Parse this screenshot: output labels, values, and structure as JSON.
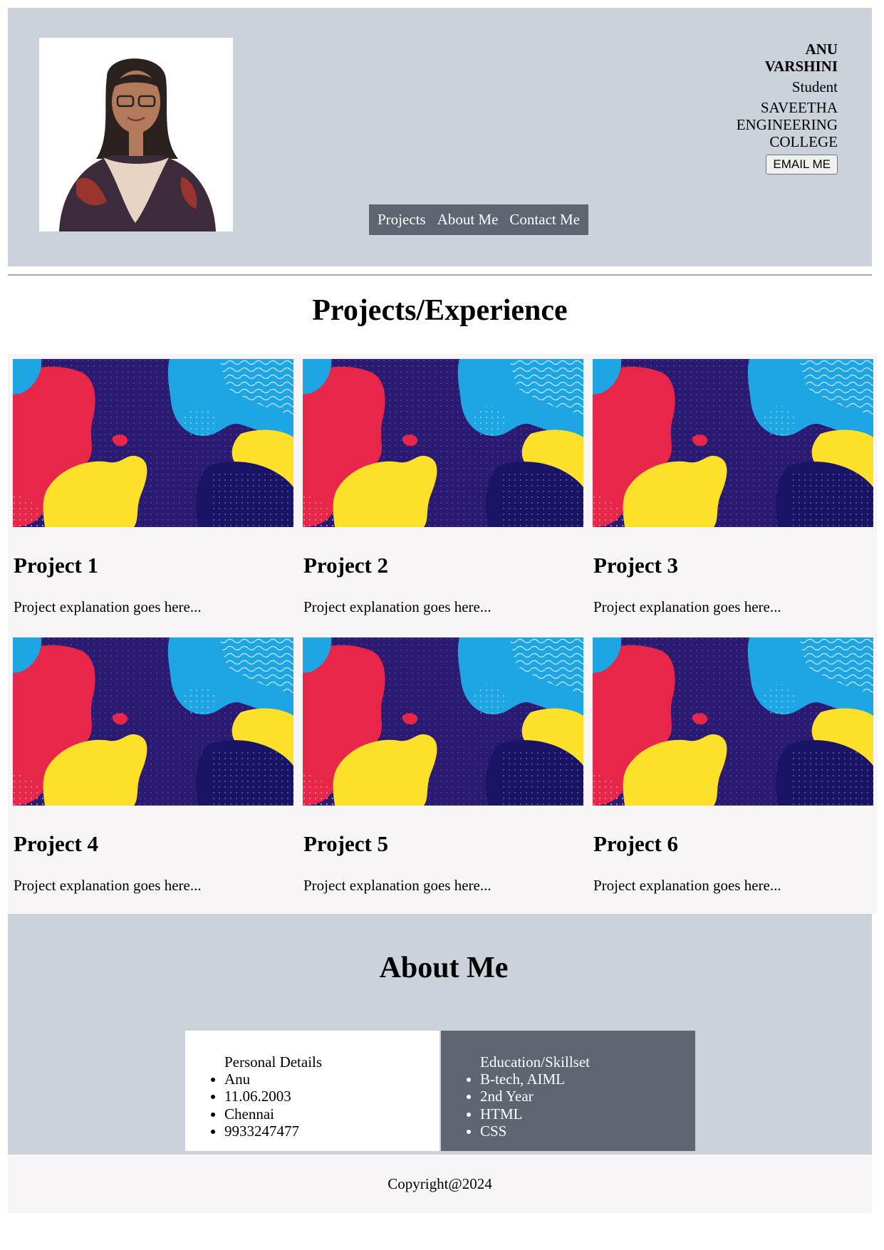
{
  "profile": {
    "name_first": "ANU",
    "name_last": "VARSHINI",
    "role": "Student",
    "college": "SAVEETHA ENGINEERING COLLEGE",
    "email_button": "EMAIL ME"
  },
  "nav": {
    "items": [
      "Projects",
      "About Me",
      "Contact Me"
    ]
  },
  "projects": {
    "title": "Projects/Experience",
    "items": [
      {
        "title": "Project 1",
        "description": "Project explanation goes here..."
      },
      {
        "title": "Project 2",
        "description": "Project explanation goes here..."
      },
      {
        "title": "Project 3",
        "description": "Project explanation goes here..."
      },
      {
        "title": "Project 4",
        "description": "Project explanation goes here..."
      },
      {
        "title": "Project 5",
        "description": "Project explanation goes here..."
      },
      {
        "title": "Project 6",
        "description": "Project explanation goes here..."
      }
    ]
  },
  "about": {
    "title": "About Me",
    "personal": {
      "heading": "Personal Details",
      "items": [
        "Anu",
        "11.06.2003",
        "Chennai",
        "9933247477"
      ]
    },
    "education": {
      "heading": "Education/Skillset",
      "items": [
        "B-tech, AIML",
        "2nd Year",
        "HTML",
        "CSS"
      ]
    }
  },
  "footer": {
    "copyright": "Copyright@2024"
  },
  "colors": {
    "header_bg": "#cbd2da",
    "nav_bg": "#5e6570",
    "projects_bg": "#f8f5f6",
    "art_navy": "#2a1a72",
    "art_red": "#e8264a",
    "art_yellow": "#fde02a",
    "art_blue": "#1ea5e3"
  }
}
